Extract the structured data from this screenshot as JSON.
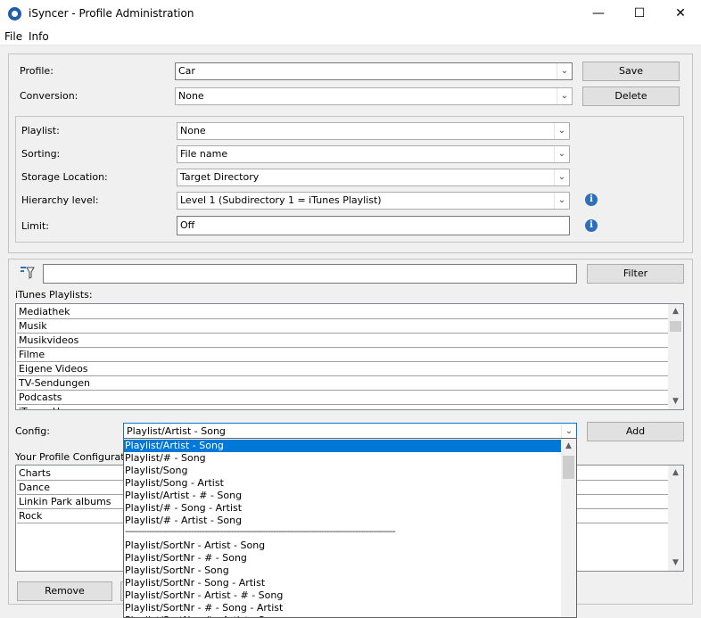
{
  "window": {
    "title": "iSyncer - Profile Administration",
    "minimize_glyph": "—",
    "maximize_glyph": "☐",
    "close_glyph": "✕"
  },
  "menu": {
    "file": "File",
    "info": "Info"
  },
  "profile": {
    "profile_label": "Profile:",
    "profile_value": "Car",
    "conversion_label": "Conversion:",
    "conversion_value": "None",
    "save_label": "Save",
    "delete_label": "Delete"
  },
  "settings": {
    "playlist_label": "Playlist:",
    "playlist_value": "None",
    "sorting_label": "Sorting:",
    "sorting_value": "File name",
    "storage_label": "Storage Location:",
    "storage_value": "Target Directory",
    "hierarchy_label": "Hierarchy level:",
    "hierarchy_value": "Level 1 (Subdirectory 1 = iTunes Playlist)",
    "limit_label": "Limit:",
    "limit_value": "Off",
    "info_glyph": "i"
  },
  "filter": {
    "input_value": "",
    "filter_label": "Filter",
    "icon": "filter-icon"
  },
  "itunes": {
    "label": "iTunes Playlists:",
    "items": [
      "Mediathek",
      "Musik",
      "Musikvideos",
      "Filme",
      "Eigene Videos",
      "TV-Sendungen",
      "Podcasts",
      "iTunes U"
    ]
  },
  "config": {
    "label": "Config:",
    "value": "Playlist/Artist - Song",
    "add_label": "Add",
    "options": [
      "Playlist/Artist - Song",
      "Playlist/# - Song",
      "Playlist/Song",
      "Playlist/Song - Artist",
      "Playlist/Artist - # - Song",
      "Playlist/# - Song - Artist",
      "Playlist/# - Artist - Song",
      "------------------------------------------------------------------------------------------------------",
      "Playlist/SortNr - Artist - Song",
      "Playlist/SortNr - # - Song",
      "Playlist/SortNr - Song",
      "Playlist/SortNr - Song - Artist",
      "Playlist/SortNr - Artist - # - Song",
      "Playlist/SortNr - # - Song - Artist",
      "Playlist/SortNr - # - Artist - Song"
    ]
  },
  "your_profile": {
    "label": "Your Profile Configuration",
    "items": [
      "Charts",
      "Dance",
      "Linkin Park albums",
      "Rock"
    ],
    "remove_label": "Remove"
  }
}
